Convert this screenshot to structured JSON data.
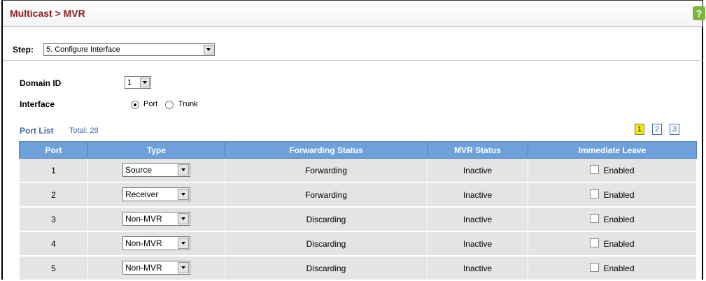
{
  "header": {
    "title": "Multicast > MVR"
  },
  "step": {
    "label": "Step:",
    "value": "5. Configure Interface"
  },
  "domain": {
    "label": "Domain ID",
    "value": "1"
  },
  "interface": {
    "label": "Interface",
    "options": [
      "Port",
      "Trunk"
    ],
    "selected": "Port"
  },
  "port_list": {
    "title": "Port List",
    "total": "Total: 28",
    "pages": [
      "1",
      "2",
      "3"
    ],
    "current_page": "1"
  },
  "table": {
    "headers": [
      "Port",
      "Type",
      "Forwarding Status",
      "MVR Status",
      "Immediate Leave"
    ],
    "rows": [
      {
        "port": "1",
        "type": "Source",
        "forwarding": "Forwarding",
        "mvr": "Inactive",
        "leave": "Enabled"
      },
      {
        "port": "2",
        "type": "Receiver",
        "forwarding": "Forwarding",
        "mvr": "Inactive",
        "leave": "Enabled"
      },
      {
        "port": "3",
        "type": "Non-MVR",
        "forwarding": "Discarding",
        "mvr": "Inactive",
        "leave": "Enabled"
      },
      {
        "port": "4",
        "type": "Non-MVR",
        "forwarding": "Discarding",
        "mvr": "Inactive",
        "leave": "Enabled"
      },
      {
        "port": "5",
        "type": "Non-MVR",
        "forwarding": "Discarding",
        "mvr": "Inactive",
        "leave": "Enabled"
      }
    ]
  },
  "colors": {
    "title": "#8b1a1a",
    "table_header": "#6ea1d9",
    "link": "#3a6aa8",
    "help": "#7ab63a"
  },
  "icons": {
    "help": "help-icon"
  }
}
